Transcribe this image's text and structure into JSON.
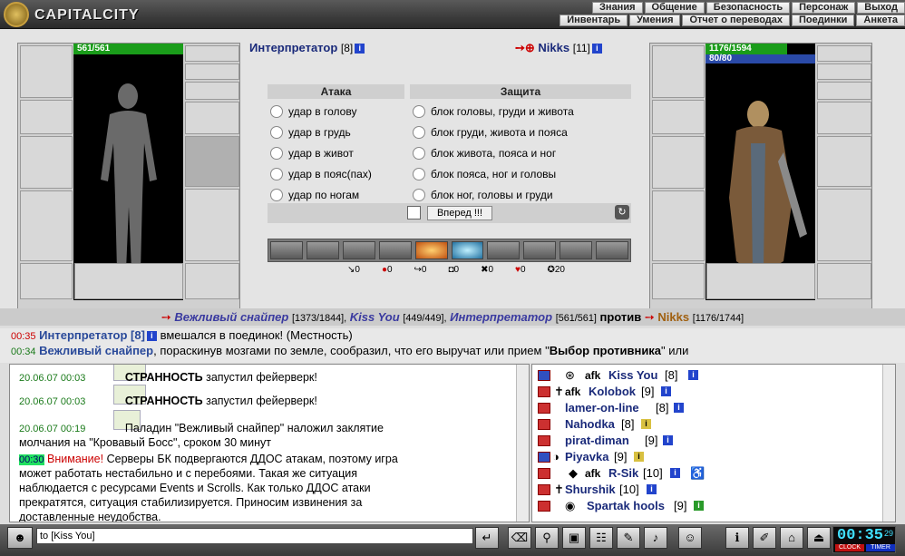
{
  "header": {
    "logo_text": "CAPITALCITY",
    "menu_top": [
      "Знания",
      "Общение",
      "Безопасность",
      "Персонаж",
      "Выход"
    ],
    "menu_bottom": [
      "Инвентарь",
      "Умения",
      "Отчет о переводах",
      "Поединки",
      "Анкета"
    ]
  },
  "left_player": {
    "name": "Интерпретатор",
    "level": "[8]",
    "hp": "561/561"
  },
  "right_player": {
    "name": "Nikks",
    "level": "[11]",
    "hp": "1176/1594",
    "mp": "80/80"
  },
  "attack": {
    "header": "Атака",
    "options": [
      "удар в голову",
      "удар в грудь",
      "удар в живот",
      "удар в пояс(пах)",
      "удар по ногам"
    ]
  },
  "defense": {
    "header": "Защита",
    "options": [
      "блок головы, груди и живота",
      "блок груди, живота и пояса",
      "блок живота, пояса и ног",
      "блок пояса, ног и головы",
      "блок ног, головы и груди"
    ]
  },
  "forward_button": "Вперед !!!",
  "stats": [
    "0",
    "0",
    "0",
    "0",
    "0",
    "0",
    "20"
  ],
  "vs": {
    "t1_name": "Вежливый снайпер",
    "t1_hp": "[1373/1844],",
    "t2_name": "Kiss You",
    "t2_hp": "[449/449],",
    "t3_name": "Интерпретатор",
    "t3_hp": "[561/561]",
    "against": "против",
    "t4_name": "Nikks",
    "t4_hp": "[1176/1744]"
  },
  "log": [
    {
      "time": "00:35",
      "name": "Интерпретатор",
      "lvl": "[8]",
      "text": "вмешался в поединок! (Местность)"
    },
    {
      "time": "00:34",
      "name": "Вежливый снайпер",
      "text1": ", пораскинув мозгами по земле, сообразил, что его выручат или прием \"",
      "bold": "Выбор противника",
      "text2": "\" или"
    }
  ],
  "chat": [
    {
      "date": "20.06.07 00:03",
      "name": "СТРАННОСТЬ",
      "text": "запустил фейерверк!"
    },
    {
      "date": "20.06.07 00:03",
      "name": "СТРАННОСТЬ",
      "text": "запустил фейерверк!"
    },
    {
      "date": "20.06.07 00:19",
      "text": "Паладин \"Вежливый снайпер\" наложил заклятие"
    },
    {
      "text": "молчания на \"Кровавый Босс\", сроком 30 минут"
    },
    {
      "time": "00:30",
      "warn": "Внимание!",
      "text": "Серверы БК подвергаются ДДОС атакам, поэтому игра"
    },
    {
      "text": "может работать нестабильно и с перебоями. Такая же ситуация"
    },
    {
      "text": "наблюдается с ресурсами Events и Scrolls. Как только ДДОС атаки"
    },
    {
      "text": "прекратятся, ситуация стабилизируется. Приносим извинения за"
    },
    {
      "text": "доставленные неудобства."
    }
  ],
  "users": [
    {
      "afk": "afk",
      "name": "Kiss You",
      "lvl": "[8]"
    },
    {
      "afk": "afk",
      "name": "Kolobok",
      "lvl": "[9]"
    },
    {
      "name": "lamer-on-line",
      "lvl": "[8]"
    },
    {
      "name": "Nahodka",
      "lvl": "[8]"
    },
    {
      "name": "pirat-diman",
      "lvl": "[9]"
    },
    {
      "name": "Piyavka",
      "lvl": "[9]"
    },
    {
      "afk": "afk",
      "name": "R-Sik",
      "lvl": "[10]"
    },
    {
      "name": "Shurshik",
      "lvl": "[10]"
    },
    {
      "name": "Spartak hools",
      "lvl": "[9]"
    }
  ],
  "message_input": "to [Kiss You]",
  "clock": {
    "time": "00:35",
    "sec": "29",
    "clock_label": "CLOCK",
    "timer_label": "TIMER"
  }
}
